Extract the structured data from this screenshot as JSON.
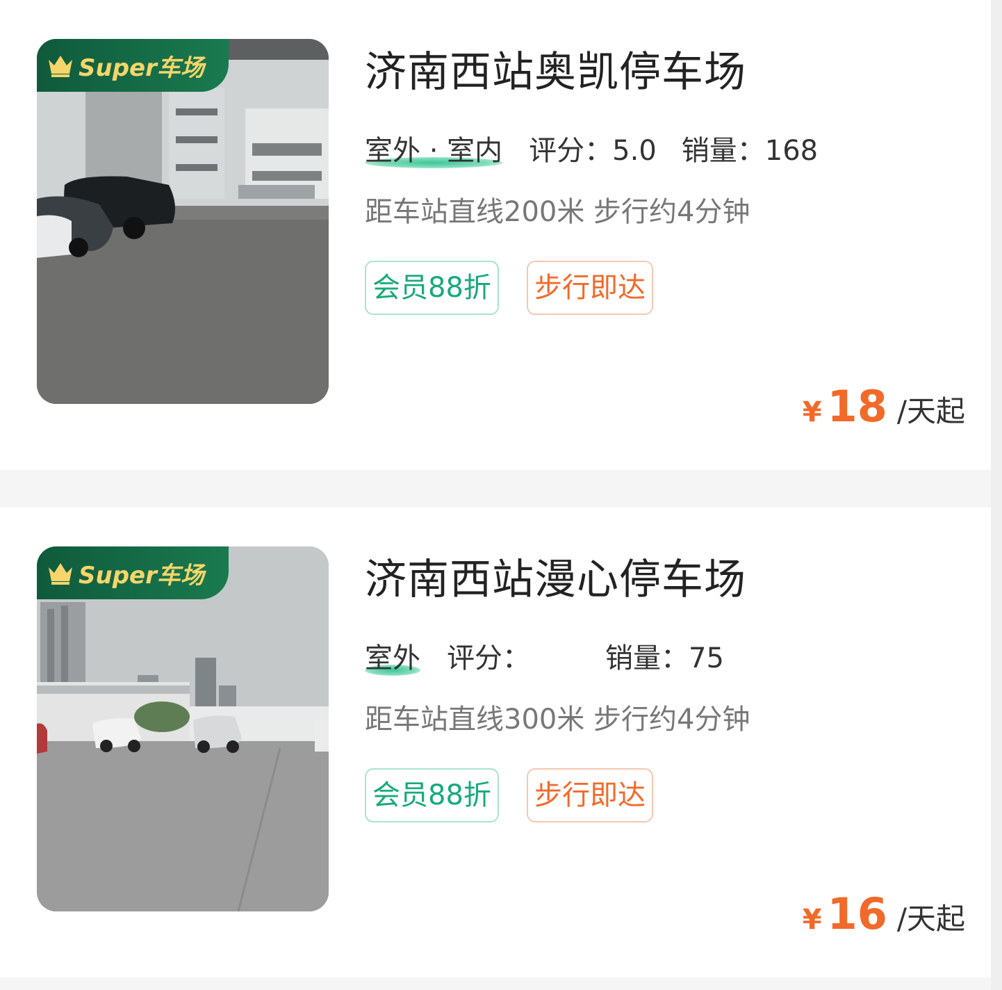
{
  "lots": [
    {
      "badge": "Super车场",
      "title": "济南西站奥凯停车场",
      "environment": "室外 · 室内",
      "rating_label": "评分：",
      "rating_value": "5.0",
      "sales_label": "销量：",
      "sales_value": "168",
      "distance": "距车站直线200米 步行约4分钟",
      "tags": [
        "会员88折",
        "步行即达"
      ],
      "price_symbol": "¥",
      "price_value": "18",
      "price_unit": "/天起"
    },
    {
      "badge": "Super车场",
      "title": "济南西站漫心停车场",
      "environment": "室外",
      "rating_label": "评分：",
      "rating_value": "",
      "sales_label": "销量：",
      "sales_value": "75",
      "distance": "距车站直线300米 步行约4分钟",
      "tags": [
        "会员88折",
        "步行即达"
      ],
      "price_symbol": "¥",
      "price_value": "16",
      "price_unit": "/天起"
    }
  ],
  "colors": {
    "accent_orange": "#f26a2a",
    "accent_green": "#17a97a",
    "badge_bg": "#0f5a3c",
    "badge_text": "#f6d56a"
  },
  "icons": [
    "crown-icon"
  ]
}
